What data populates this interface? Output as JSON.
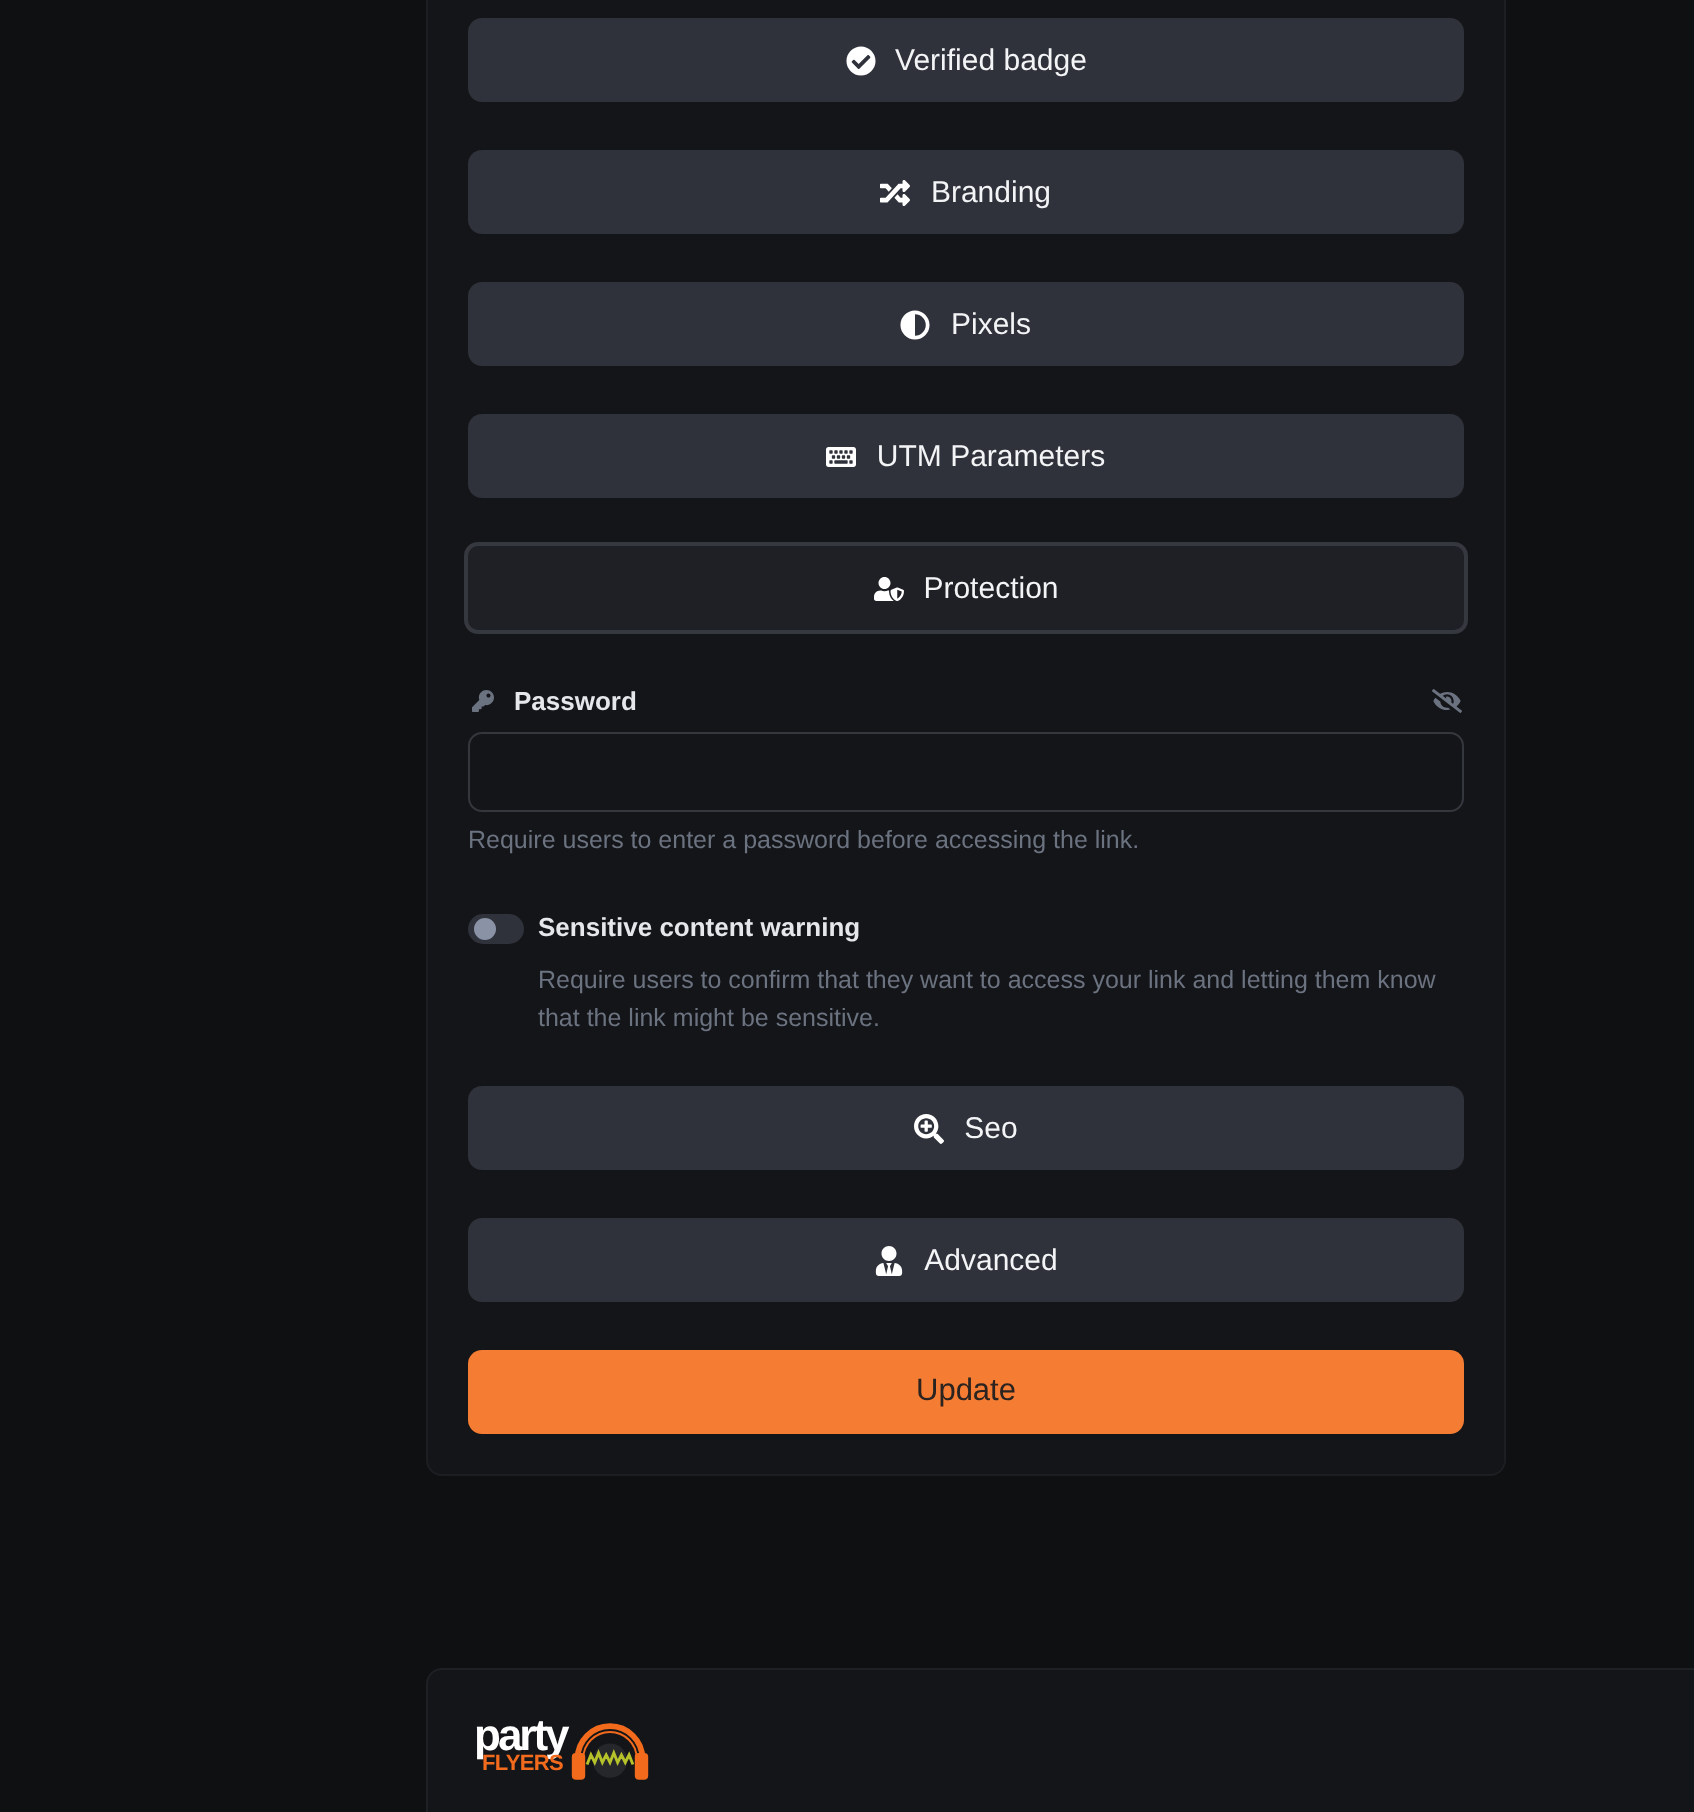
{
  "sections": [
    {
      "label": "Verified badge",
      "expanded": false
    },
    {
      "label": "Branding",
      "expanded": false
    },
    {
      "label": "Pixels",
      "expanded": false
    },
    {
      "label": "UTM Parameters",
      "expanded": false
    },
    {
      "label": "Protection",
      "expanded": true,
      "fields": [
        {
          "kind": "password",
          "label": "Password",
          "help": "Require users to enter a password before accessing the link."
        },
        {
          "kind": "toggle",
          "label": "Sensitive content warning",
          "on": false,
          "help": "Require users to confirm that they want to access your link and letting them know that the link might be sensitive."
        }
      ]
    },
    {
      "label": "Seo",
      "expanded": false
    },
    {
      "label": "Advanced",
      "expanded": false
    }
  ],
  "submit": {
    "label": "Update"
  },
  "footer": {
    "logo": {
      "word": "party",
      "subword": "FLYERS"
    }
  }
}
